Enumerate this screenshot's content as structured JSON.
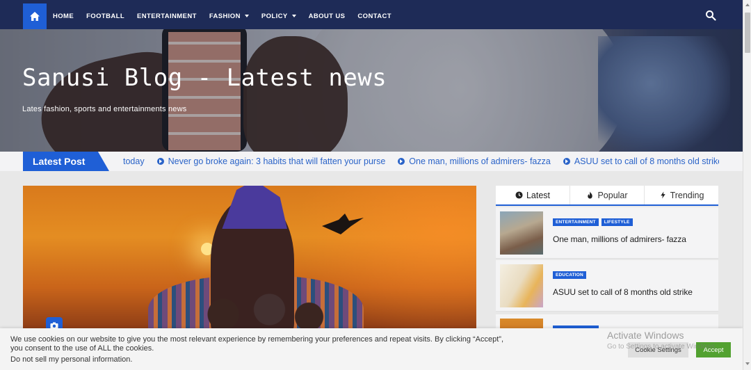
{
  "nav": {
    "home_icon": "home-icon",
    "items": [
      {
        "label": "HOME",
        "dropdown": false
      },
      {
        "label": "FOOTBALL",
        "dropdown": false
      },
      {
        "label": "ENTERTAINMENT",
        "dropdown": false
      },
      {
        "label": "FASHION",
        "dropdown": true
      },
      {
        "label": "POLICY",
        "dropdown": true
      },
      {
        "label": "ABOUT US",
        "dropdown": false
      },
      {
        "label": "CONTACT",
        "dropdown": false
      }
    ],
    "search_icon": "search-icon"
  },
  "hero": {
    "title": "Sanusi Blog - Latest news",
    "subtitle": "Lates fashion, sports and entertainments news"
  },
  "ticker": {
    "label": "Latest Post",
    "items": [
      {
        "text": "today",
        "arrow": false
      },
      {
        "text": "Never go broke again: 3 habits that will fatten your purse",
        "arrow": true
      },
      {
        "text": "One man, millions of admirers- fazza",
        "arrow": true
      },
      {
        "text": "ASUU set to call of 8 months old strike",
        "arrow": true
      }
    ]
  },
  "sidebar": {
    "tabs": [
      {
        "label": "Latest",
        "icon": "clock-icon"
      },
      {
        "label": "Popular",
        "icon": "fire-icon"
      },
      {
        "label": "Trending",
        "icon": "bolt-icon"
      }
    ],
    "posts": [
      {
        "badges": [
          "ENTERTAINMENT",
          "LIFESTYLE"
        ],
        "title": "One man, millions of admirers- fazza"
      },
      {
        "badges": [
          "EDUCATION"
        ],
        "title": "ASUU set to call of 8 months old strike"
      },
      {
        "badges": [
          ""
        ],
        "title": ""
      }
    ]
  },
  "cookie": {
    "text": "We use cookies on our website to give you the most relevant experience by remembering your preferences and repeat visits. By clicking “Accept”, you consent to the use of ALL the cookies.",
    "do_not_sell": "Do not sell my personal information.",
    "settings_label": "Cookie Settings",
    "accept_label": "Accept"
  },
  "watermark": {
    "title": "Activate Windows",
    "subtitle": "Go to Settings to activate Windows."
  },
  "colors": {
    "navbar": "#1e2b57",
    "accent": "#1f5fd6",
    "accept": "#52a130",
    "link": "#2a63c8"
  }
}
